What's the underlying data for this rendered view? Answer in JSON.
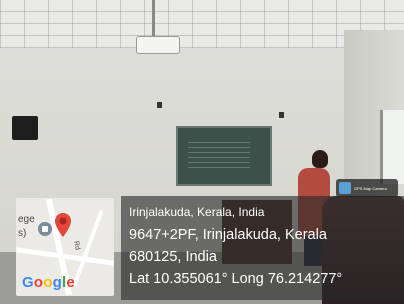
{
  "geotag": {
    "app_badge": "GPS Map Camera",
    "place": "Irinjalakuda, Kerala, India",
    "address_line1": "9647+2PF, Irinjalakuda, Kerala",
    "address_line2": "680125, India",
    "coordinates": "Lat 10.355061° Long 76.214277°"
  },
  "map": {
    "label_fragment_1": "ege",
    "label_fragment_2": "s)",
    "road_label": "Rd",
    "provider": "Google",
    "pin_color": "#e2473a",
    "poi_icon": "school-icon"
  },
  "colors": {
    "overlay_bg": "rgba(40,40,40,0.62)",
    "google_blue": "#4285F4",
    "google_red": "#EA4335",
    "google_yellow": "#FBBC05",
    "google_green": "#34A853"
  }
}
